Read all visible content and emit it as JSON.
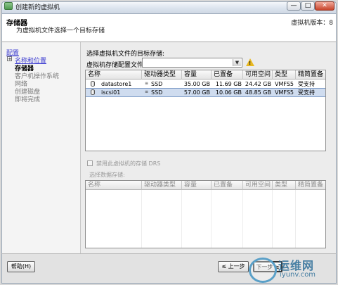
{
  "window": {
    "title": "创建新的虚拟机",
    "min_glyph": "—",
    "max_glyph": "□",
    "close_glyph": "✕"
  },
  "header": {
    "title": "存储器",
    "subtitle": "为虚拟机文件选择一个目标存储",
    "version": "虚拟机版本：8"
  },
  "nav": {
    "items": [
      {
        "label": "配置",
        "state": "link"
      },
      {
        "label": "名称和位置",
        "state": "link"
      },
      {
        "label": "存储器",
        "state": "current"
      },
      {
        "label": "客户机操作系统",
        "state": "plain"
      },
      {
        "label": "网络",
        "state": "plain"
      },
      {
        "label": "创建磁盘",
        "state": "plain"
      },
      {
        "label": "即将完成",
        "state": "plain"
      }
    ],
    "expander": "+"
  },
  "main": {
    "select_label": "选择虚拟机文件的目标存储:",
    "profile_label": "虚拟机存储配置文件:",
    "profile_value": "",
    "warning_mark": "!",
    "columns": [
      "名称",
      "驱动器类型",
      "容量",
      "已置备",
      "可用空间",
      "类型",
      "精简置备"
    ],
    "datastores": [
      {
        "name": "datastore1",
        "drive": "SSD",
        "capacity": "35.00 GB",
        "provisioned": "11.69 GB",
        "free": "24.42 GB",
        "type": "VMFS5",
        "thin": "受支持"
      },
      {
        "name": "iscsi01",
        "drive": "SSD",
        "capacity": "57.00 GB",
        "provisioned": "10.06 GB",
        "free": "48.85 GB",
        "type": "VMFS5",
        "thin": "受支持"
      }
    ],
    "drs_label": "禁用此虚拟机的存储 DRS",
    "ds2_label": "选择数据存储:",
    "ds2_columns": [
      "名称",
      "驱动器类型",
      "容量",
      "已置备",
      "可用空间",
      "类型",
      "精简置备"
    ]
  },
  "footer": {
    "help": "帮助(H)",
    "back": "≤ 上一步",
    "next": "下一步 ≥"
  },
  "watermark": {
    "text": "运维网",
    "domain": "iyunv.com"
  }
}
